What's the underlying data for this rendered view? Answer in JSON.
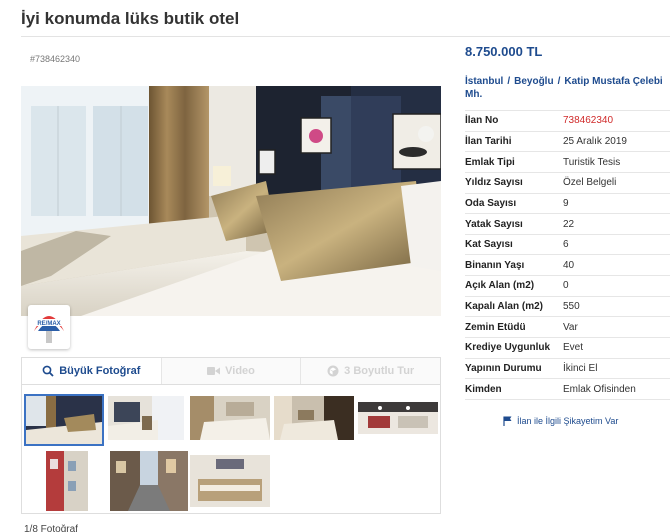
{
  "listing": {
    "title": "İyi konumda lüks butik otel",
    "ad_id_small": "#738462340",
    "price": "8.750.000 TL",
    "location": [
      "İstanbul",
      "Beyoğlu",
      "Katip Mustafa Çelebi Mh."
    ]
  },
  "details": [
    {
      "key": "İlan No",
      "value": "738462340",
      "highlight": true
    },
    {
      "key": "İlan Tarihi",
      "value": "25 Aralık 2019"
    },
    {
      "key": "Emlak Tipi",
      "value": "Turistik Tesis"
    },
    {
      "key": "Yıldız Sayısı",
      "value": "Özel Belgeli"
    },
    {
      "key": "Oda Sayısı",
      "value": "9"
    },
    {
      "key": "Yatak Sayısı",
      "value": "22"
    },
    {
      "key": "Kat Sayısı",
      "value": "6"
    },
    {
      "key": "Binanın Yaşı",
      "value": "40"
    },
    {
      "key": "Açık Alan (m2)",
      "value": "0"
    },
    {
      "key": "Kapalı Alan (m2)",
      "value": "550"
    },
    {
      "key": "Zemin Etüdü",
      "value": "Var"
    },
    {
      "key": "Krediye Uygunluk",
      "value": "Evet"
    },
    {
      "key": "Yapının Durumu",
      "value": "İkinci El"
    },
    {
      "key": "Kimden",
      "value": "Emlak Ofisinden"
    }
  ],
  "tabs": [
    {
      "label": "Büyük Fotoğraf",
      "icon": "search-icon",
      "active": true
    },
    {
      "label": "Video",
      "icon": "video-icon",
      "active": false
    },
    {
      "label": "3 Boyutlu Tur",
      "icon": "cube-icon",
      "active": false
    }
  ],
  "gallery": {
    "photo_count": "1/8 Fotoğraf",
    "thumbnails": [
      "thumb-1",
      "thumb-2",
      "thumb-3",
      "thumb-4",
      "thumb-5",
      "thumb-6",
      "thumb-7",
      "thumb-8"
    ],
    "badge_text": "RE/MAX"
  },
  "complaint_link": "İlan ile İlgili Şikayetim Var",
  "colors": {
    "accent": "#1e4b8e",
    "highlight": "#d02a2a"
  }
}
